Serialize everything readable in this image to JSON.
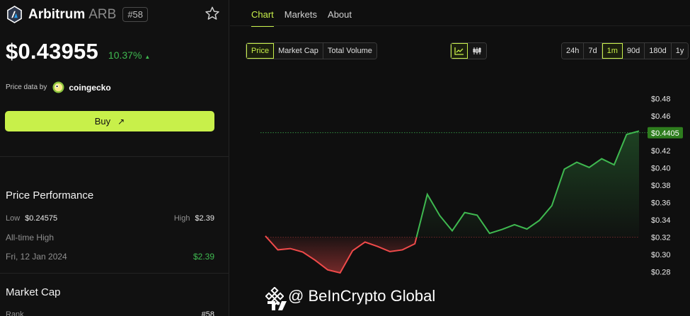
{
  "coin": {
    "name": "Arbitrum",
    "symbol": "ARB",
    "rank": "#58",
    "price": "$0.43955",
    "change": "10.37%",
    "price_source_label": "Price data by",
    "price_source_name": "coingecko"
  },
  "buy_button": {
    "label": "Buy",
    "arrow": "↗"
  },
  "performance": {
    "title": "Price Performance",
    "low_label": "Low",
    "low_value": "$0.24575",
    "high_label": "High",
    "high_value": "$2.39",
    "ath_label": "All-time High",
    "ath_date": "Fri, 12 Jan 2024",
    "ath_value": "$2.39"
  },
  "market_cap": {
    "title": "Market Cap",
    "rank_label": "Rank",
    "rank_value": "#58"
  },
  "tabs": [
    {
      "label": "Chart",
      "active": true
    },
    {
      "label": "Markets",
      "active": false
    },
    {
      "label": "About",
      "active": false
    }
  ],
  "metric_toggle": [
    "Price",
    "Market Cap",
    "Total Volume"
  ],
  "chart_style_icons": [
    "line-chart-icon",
    "candlestick-icon"
  ],
  "timeframes": [
    "24h",
    "7d",
    "1m",
    "90d",
    "180d",
    "1y"
  ],
  "active_timeframe": "1m",
  "colors": {
    "accent": "#c8f04a",
    "up": "#3fb950",
    "down": "#f04a4a",
    "background": "#0f0f0f"
  },
  "watermark": {
    "text": "@ BeInCrypto Global"
  },
  "chart_data": {
    "type": "area",
    "y_ticks": [
      "$0.48",
      "$0.46",
      "$0.44",
      "$0.42",
      "$0.40",
      "$0.38",
      "$0.36",
      "$0.34",
      "$0.32",
      "$0.30",
      "$0.28"
    ],
    "ylim": [
      0.27,
      0.49
    ],
    "baseline": 0.32,
    "current_price_label": "$0.4405",
    "current_price": 0.4405,
    "values": [
      0.3215,
      0.3055,
      0.307,
      0.303,
      0.2935,
      0.2825,
      0.279,
      0.3045,
      0.3145,
      0.3095,
      0.3035,
      0.3055,
      0.3125,
      0.3695,
      0.345,
      0.3275,
      0.3485,
      0.3455,
      0.3245,
      0.329,
      0.3345,
      0.3295,
      0.3395,
      0.3565,
      0.3985,
      0.4065,
      0.4005,
      0.4105,
      0.4035,
      0.4385,
      0.4425
    ]
  }
}
